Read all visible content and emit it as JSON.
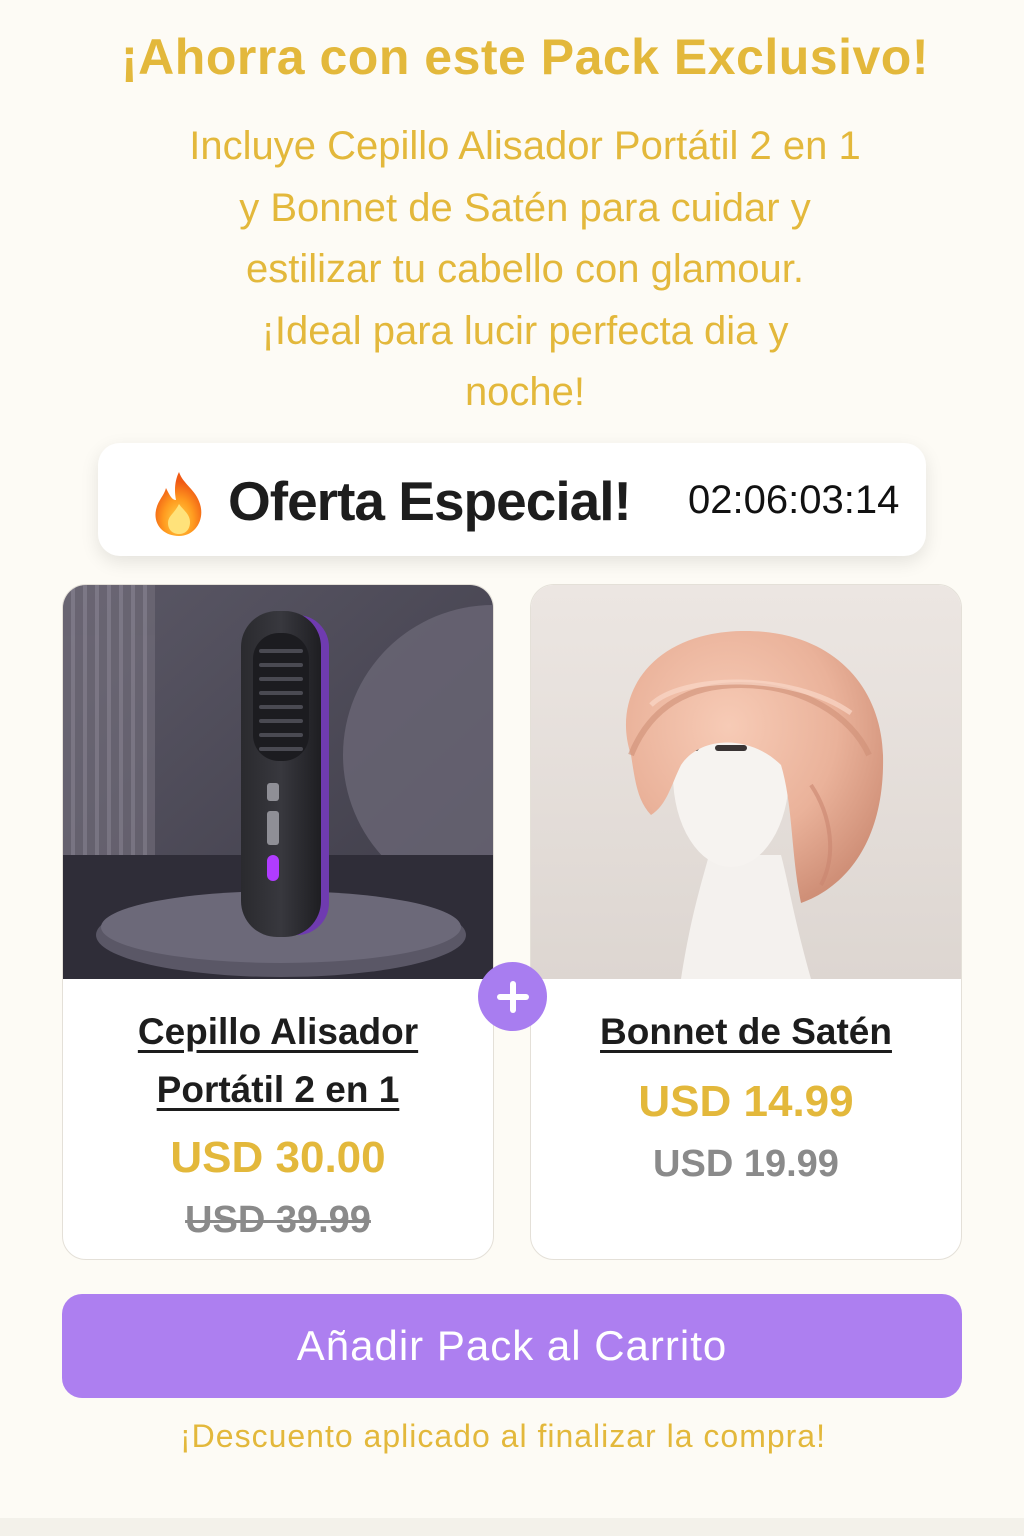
{
  "header": {
    "title": "¡Ahorra con este Pack Exclusivo!",
    "description": "Incluye Cepillo Alisador Portátil 2 en 1\ny Bonnet de Satén para cuidar y\nestilizar tu cabello con glamour.\n¡Ideal para lucir perfecta dia y\nnoche!"
  },
  "offer": {
    "icon": "fire-icon",
    "label": "Oferta Especial!",
    "countdown": "02:06:03:14"
  },
  "products": [
    {
      "name": "Cepillo Alisador\nPortátil 2 en 1",
      "price": "USD 30.00",
      "original_price": "USD 39.99",
      "original_price_struck": true,
      "image": "hair-straightener-brush-image"
    },
    {
      "name": "Bonnet de Satén",
      "price": "USD 14.99",
      "original_price": "USD 19.99",
      "original_price_struck": false,
      "image": "satin-bonnet-image"
    }
  ],
  "plus_icon": "plus-icon",
  "cart_button": {
    "label": "Añadir Pack al Carrito"
  },
  "footnote": "¡Descuento aplicado al finalizar la compra!",
  "colors": {
    "accent_gold": "#e3b83b",
    "button_purple": "#ad7ff0",
    "background": "#fdfbf5",
    "old_price_gray": "#8a8a8a"
  }
}
